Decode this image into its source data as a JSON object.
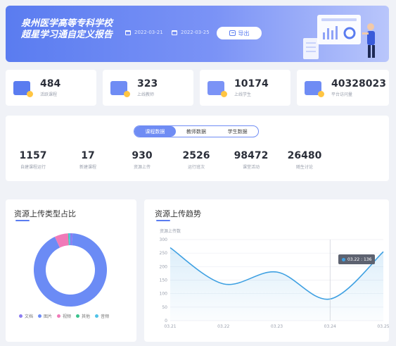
{
  "header": {
    "title_line1": "泉州医学高等专科学校",
    "title_line2": "超星学习通自定义报告",
    "start_date": "2022-03-21",
    "end_date": "2022-03-25",
    "export_label": "导出"
  },
  "stats": [
    {
      "value": "484",
      "label": "活跃课程",
      "color": "#5a7cf0"
    },
    {
      "value": "323",
      "label": "上线教师",
      "color": "#6f8cf4"
    },
    {
      "value": "10174",
      "label": "上线学生",
      "color": "#7b93f6"
    },
    {
      "value": "40328023",
      "label": "平台访问量",
      "color": "#6f8cf4"
    }
  ],
  "tabs": [
    {
      "label": "课程数据",
      "active": true
    },
    {
      "label": "教师数据",
      "active": false
    },
    {
      "label": "学生数据",
      "active": false
    }
  ],
  "metrics": [
    {
      "value": "1157",
      "label": "自建课程运行"
    },
    {
      "value": "17",
      "label": "新建课程"
    },
    {
      "value": "930",
      "label": "资源上传"
    },
    {
      "value": "2526",
      "label": "运行班次"
    },
    {
      "value": "98472",
      "label": "课堂活动"
    },
    {
      "value": "26480",
      "label": "随生讨论"
    }
  ],
  "pie_panel": {
    "title": "资源上传类型占比",
    "legend": [
      {
        "label": "文档",
        "color": "#8b7cf0"
      },
      {
        "label": "图片",
        "color": "#6b8bf5"
      },
      {
        "label": "视频",
        "color": "#f07ab8"
      },
      {
        "label": "其他",
        "color": "#3ac28d"
      },
      {
        "label": "音频",
        "color": "#4fc3e8"
      }
    ]
  },
  "line_panel": {
    "title": "资源上传趋势",
    "tooltip_label": "03.22 : 136"
  },
  "chart_data": [
    {
      "type": "pie",
      "categories": [
        "文档",
        "图片",
        "视频",
        "其他",
        "音频"
      ],
      "values": [
        1,
        92,
        6,
        0.3,
        0.7
      ],
      "colors": [
        "#8b7cf0",
        "#6b8bf5",
        "#f07ab8",
        "#3ac28d",
        "#4fc3e8"
      ]
    },
    {
      "type": "line",
      "ylabel": "资源上传数",
      "x": [
        "03.21",
        "03.22",
        "03.23",
        "03.24",
        "03.25"
      ],
      "series": [
        {
          "values": [
            270,
            136,
            180,
            80,
            255
          ]
        }
      ],
      "ylim": [
        0,
        300
      ],
      "yticks": [
        0,
        50,
        100,
        150,
        200,
        250,
        300
      ],
      "color": "#3ea0e2"
    }
  ]
}
